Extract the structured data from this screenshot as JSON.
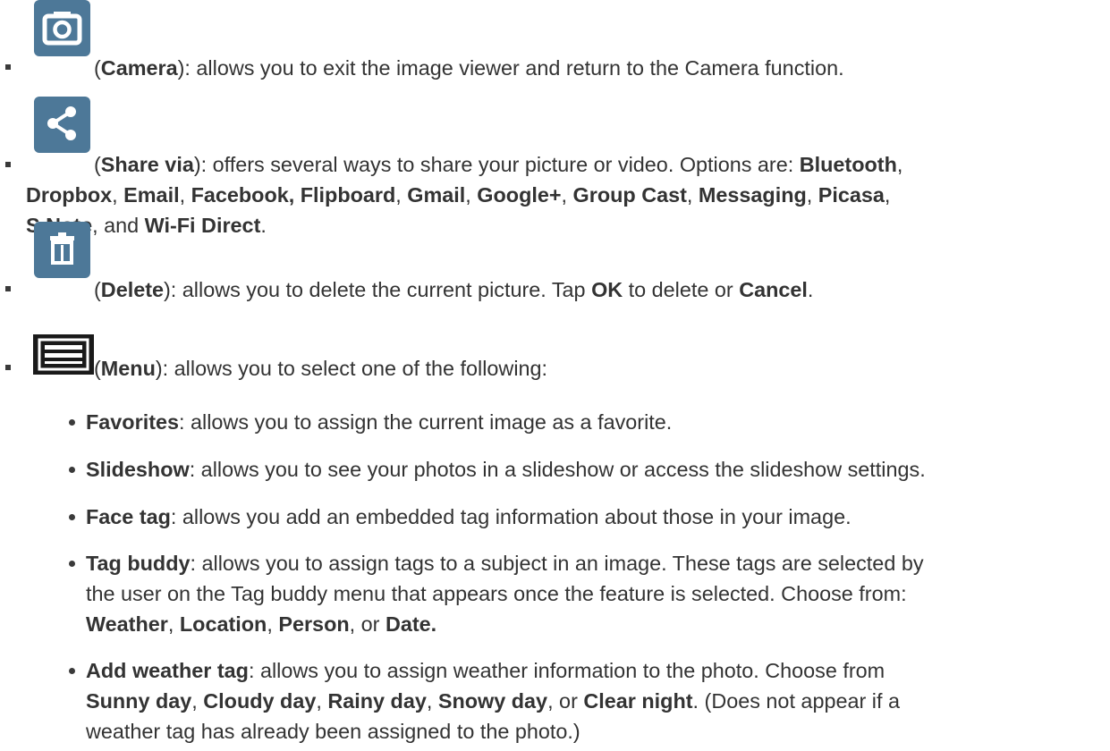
{
  "items": {
    "camera": {
      "icon": "camera-icon",
      "name": "Camera",
      "desc": "): allows you to exit the image viewer and return to the Camera function."
    },
    "share": {
      "icon": "share-icon",
      "name": "Share via",
      "desc": "): offers several ways to share your picture or video. Options are: ",
      "options": [
        "Bluetooth",
        "Dropbox",
        "Email",
        "Facebook, Flipboard",
        "Gmail",
        "Google+",
        "Group Cast",
        "Messaging",
        "Picasa",
        "S Note",
        "Wi-Fi Direct"
      ]
    },
    "delete": {
      "icon": "trash-icon",
      "name": "Delete",
      "desc": "): allows you to delete the current picture. Tap ",
      "ok": "OK",
      "mid": " to delete or ",
      "cancel": "Cancel"
    },
    "menu": {
      "icon": "menu-icon",
      "name": "Menu",
      "desc": "): allows you to select one of the following:"
    }
  },
  "submenu": {
    "favorites": {
      "name": "Favorites",
      "desc": ": allows you to assign the current image as a favorite."
    },
    "slideshow": {
      "name": "Slideshow",
      "desc": ": allows you to see your photos in a slideshow or access the slideshow settings."
    },
    "face_tag": {
      "name": "Face tag",
      "desc": ": allows you add an embedded tag information about those in your image."
    },
    "tag_buddy": {
      "name": "Tag buddy",
      "desc1": ": allows you to assign tags to a subject in an image. These tags are selected by",
      "desc2": "the user on the Tag buddy menu that appears once the feature is selected. Choose from:",
      "choices": [
        "Weather",
        "Location",
        "Person",
        "Date."
      ]
    },
    "weather_tag": {
      "name": "Add weather tag",
      "desc1": ": allows you to assign weather information to the photo. Choose from",
      "choices": [
        "Sunny day",
        "Cloudy day",
        "Rainy day",
        "Snowy day",
        "Clear night"
      ],
      "after": ". (Does not appear if a",
      "desc3": "weather tag has already been assigned to the photo.)"
    }
  },
  "colors": {
    "text": "#333333",
    "icon_tile": "#4d7898",
    "bullet": "#3a3a3a"
  }
}
